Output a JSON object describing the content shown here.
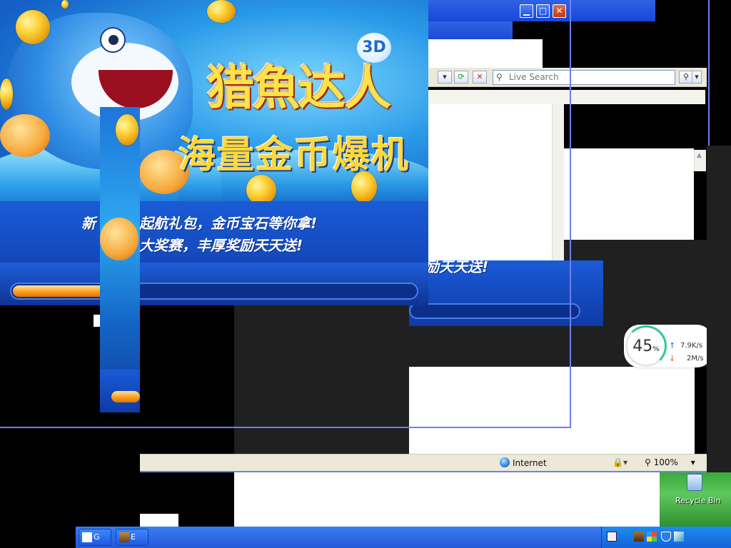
{
  "game": {
    "logo_title": "猎魚达人",
    "logo_badge": "3D",
    "slogan": "海量金币爆机",
    "promo_line1": "新手起航礼包，金币宝石等你拿!",
    "promo_line1_visible": "新",
    "promo_line1_right": "起航礼包，金币宝石等你拿!",
    "promo_line2_right": "大奖赛，丰厚奖励天天送!",
    "promo_ghost": "励天天送!",
    "progress": 0.3
  },
  "ie": {
    "search_placeholder": "Live Search",
    "status_zone": "Internet",
    "zoom": "100%"
  },
  "speed_widget": {
    "percent": "45",
    "percent_unit": "%",
    "upload": "7.9K/s",
    "download": "2M/s"
  },
  "desktop": {
    "recycle_bin_label": "Recycle Bin"
  },
  "taskbar": {
    "task1_label": "G",
    "task2_label": "E"
  },
  "colors": {
    "accent": "#2459d8",
    "ring": "#2fc98d"
  }
}
